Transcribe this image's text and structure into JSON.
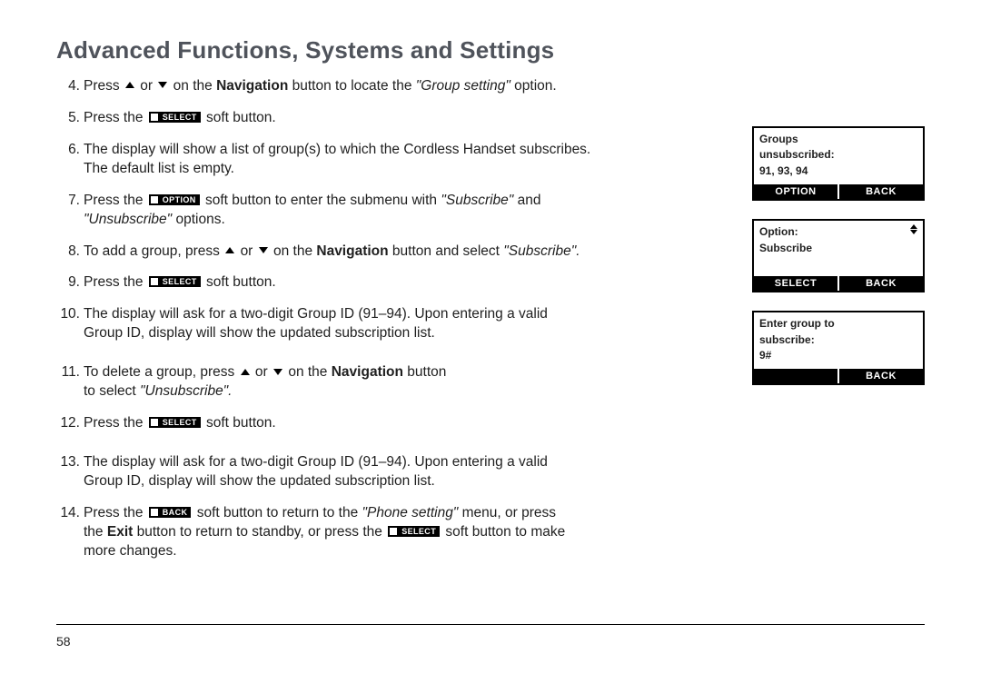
{
  "title": "Advanced Functions, Systems and Settings",
  "page_number": "58",
  "softkeys": {
    "select": "SELECT",
    "option": "OPTION",
    "back": "BACK"
  },
  "steps": {
    "s4": {
      "num": "4.",
      "pre": "Press ",
      "mid": " or ",
      "after_arrows": " on the ",
      "nav": "Navigation",
      "after_nav": " button to locate the ",
      "quoted": "\"Group setting\"",
      "tail": " option."
    },
    "s5": {
      "num": "5.",
      "pre": "Press the ",
      "tail": " soft button."
    },
    "s6": {
      "num": "6.",
      "line1": "The display will show a list of group(s) to which the Cordless Handset subscribes.",
      "line2": "The default list is empty."
    },
    "s7": {
      "num": "7.",
      "pre": "Press the ",
      "after_key": " soft button to enter the submenu with ",
      "q1": "\"Subscribe\"",
      "and": " and ",
      "q2": "\"Unsubscribe\"",
      "tail": " options."
    },
    "s8": {
      "num": "8.",
      "pre": "To add a group, press ",
      "mid": " or ",
      "after_arrows": " on the ",
      "nav": "Navigation",
      "after_nav": " button and select ",
      "q": "\"Subscribe\".",
      "tail": ""
    },
    "s9": {
      "num": "9.",
      "pre": "Press the ",
      "tail": " soft button."
    },
    "s10": {
      "num": "10.",
      "line1": "The display will ask for a two-digit Group ID (91–94). Upon entering a valid",
      "line2": "Group ID,  display will show the updated subscription list."
    },
    "s11": {
      "num": "11.",
      "pre": "To delete a group, press ",
      "mid": " or ",
      "after_arrows": " on the ",
      "nav": "Navigation",
      "after_nav": " button",
      "line2_pre": "to select ",
      "q": "\"Unsubscribe\"."
    },
    "s12": {
      "num": "12.",
      "pre": "Press the ",
      "tail": " soft button."
    },
    "s13": {
      "num": "13.",
      "line1": "The display will ask for a two-digit Group ID (91–94). Upon entering a valid",
      "line2": "Group ID,  display will show the updated subscription list."
    },
    "s14": {
      "num": "14.",
      "pre": "Press the ",
      "after_back": " soft button to return to the ",
      "q": "\"Phone setting\"",
      "after_q": " menu, or press",
      "line2_pre": "the ",
      "exit": "Exit",
      "after_exit": " button to return to standby, or press the ",
      "after_select": " soft button to make",
      "line3": "more changes."
    }
  },
  "screens": {
    "a": {
      "l1": "Groups",
      "l2": "unsubscribed:",
      "l3": "91, 93, 94",
      "left": "OPTION",
      "right": "BACK"
    },
    "b": {
      "l1": "Option:",
      "l2": "Subscribe",
      "left": "SELECT",
      "right": "BACK",
      "has_arrows": true
    },
    "c": {
      "l1": "Enter group to",
      "l2": "subscribe:",
      "l3": "9#",
      "left": "",
      "right": "BACK"
    }
  }
}
